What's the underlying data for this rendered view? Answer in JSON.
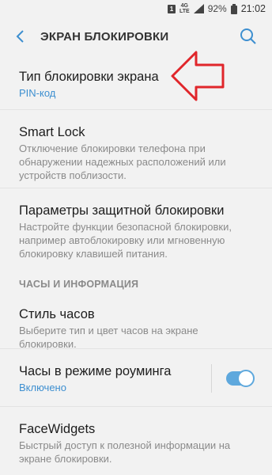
{
  "status": {
    "sim_badge": "1",
    "network": "4G",
    "network_sub": "LTE",
    "battery": "92%",
    "time": "21:02"
  },
  "header": {
    "title": "ЭКРАН БЛОКИРОВКИ"
  },
  "items": [
    {
      "title": "Тип блокировки экрана",
      "subtitle": "PIN-код"
    },
    {
      "title": "Smart Lock",
      "subtitle": "Отключение блокировки телефона при обнаружении надежных расположений или устройств поблизости."
    },
    {
      "title": "Параметры защитной блокировки",
      "subtitle": "Настройте функции безопасной блокировки, например автоблокировку или мгновенную блокировку клавишей питания."
    }
  ],
  "section": {
    "title": "ЧАСЫ И ИНФОРМАЦИЯ"
  },
  "items2": [
    {
      "title": "Стиль часов",
      "subtitle": "Выберите тип и цвет часов на экране блокировки."
    },
    {
      "title": "Часы в режиме роуминга",
      "subtitle": "Включено"
    },
    {
      "title": "FaceWidgets",
      "subtitle": "Быстрый доступ к полезной информации на экране блокировки."
    }
  ],
  "colors": {
    "accent": "#3d8fd0",
    "arrow": "#e0262b",
    "toggle": "#5ea8dd"
  }
}
